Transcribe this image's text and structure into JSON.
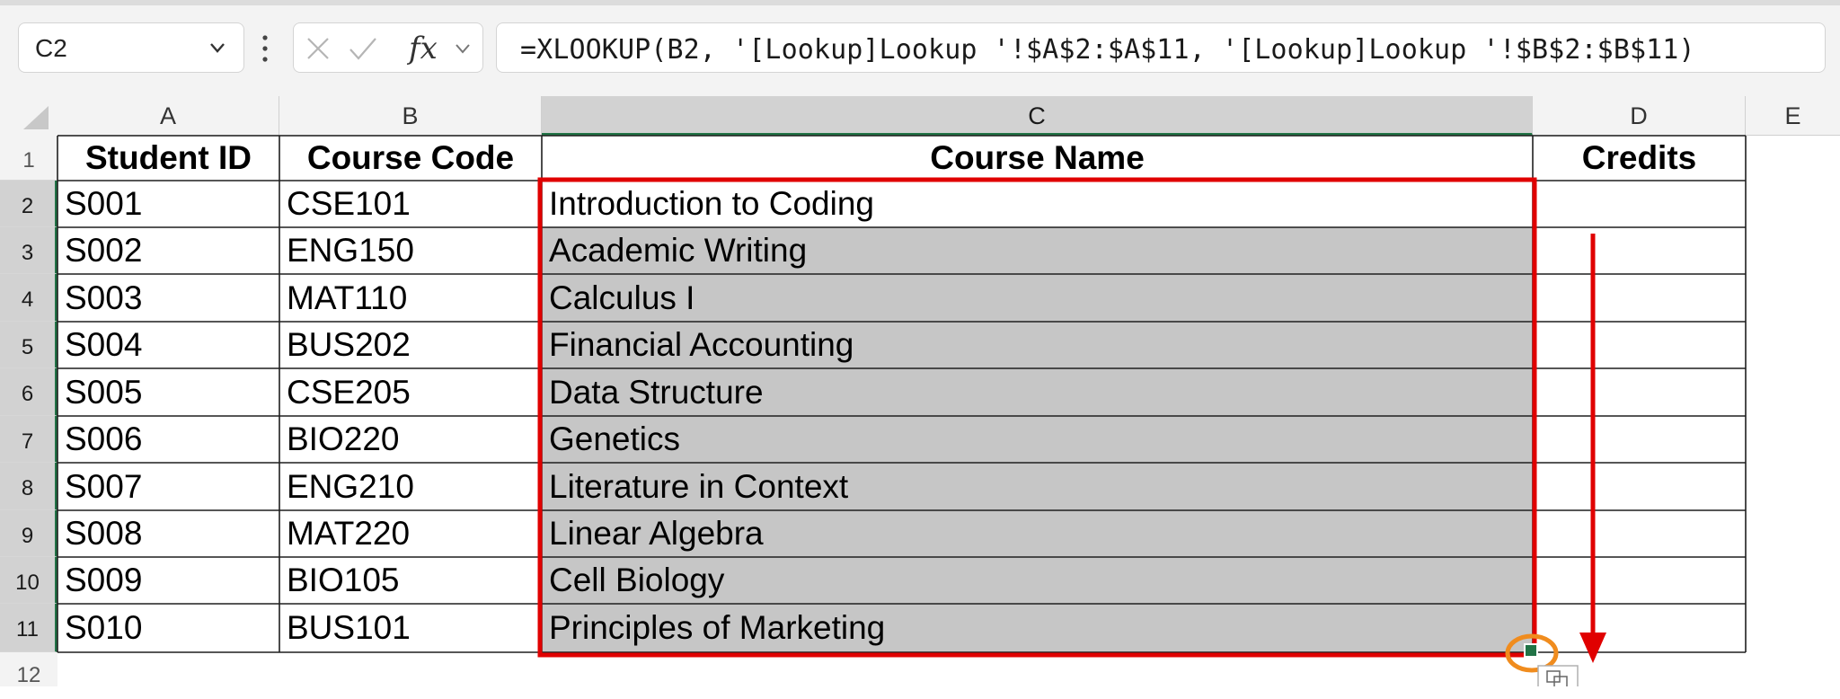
{
  "name_box": {
    "value": "C2"
  },
  "formula_bar": {
    "fx_label": "fx",
    "formula": "=XLOOKUP(B2, '[Lookup]Lookup '!$A$2:$A$11, '[Lookup]Lookup '!$B$2:$B$11)"
  },
  "columns": [
    "A",
    "B",
    "C",
    "D",
    "E"
  ],
  "rows": [
    "1",
    "2",
    "3",
    "4",
    "5",
    "6",
    "7",
    "8",
    "9",
    "10",
    "11",
    "12"
  ],
  "table": {
    "headers": [
      "Student ID",
      "Course Code",
      "Course Name",
      "Credits"
    ],
    "data": [
      [
        "S001",
        "CSE101",
        "Introduction to Coding",
        ""
      ],
      [
        "S002",
        "ENG150",
        "Academic Writing",
        ""
      ],
      [
        "S003",
        "MAT110",
        "Calculus I",
        ""
      ],
      [
        "S004",
        "BUS202",
        "Financial Accounting",
        ""
      ],
      [
        "S005",
        "CSE205",
        "Data Structure",
        ""
      ],
      [
        "S006",
        "BIO220",
        "Genetics",
        ""
      ],
      [
        "S007",
        "ENG210",
        "Literature in Context",
        ""
      ],
      [
        "S008",
        "MAT220",
        "Linear Algebra",
        ""
      ],
      [
        "S009",
        "BIO105",
        "Cell Biology",
        ""
      ],
      [
        "S010",
        "BUS101",
        "Principles of Marketing",
        ""
      ]
    ]
  },
  "colors": {
    "selection_fill": "#c6c6c6",
    "highlight_red": "#e00000",
    "fill_handle_circle": "#f08c1e",
    "active_header_accent": "#217346"
  },
  "icons": {
    "name_box_dropdown": "chevron-down-icon",
    "cancel": "x-icon",
    "enter": "checkmark-icon",
    "function": "fx-icon",
    "fx_dropdown": "chevron-down-icon",
    "quick_analysis": "quick-analysis-icon"
  }
}
